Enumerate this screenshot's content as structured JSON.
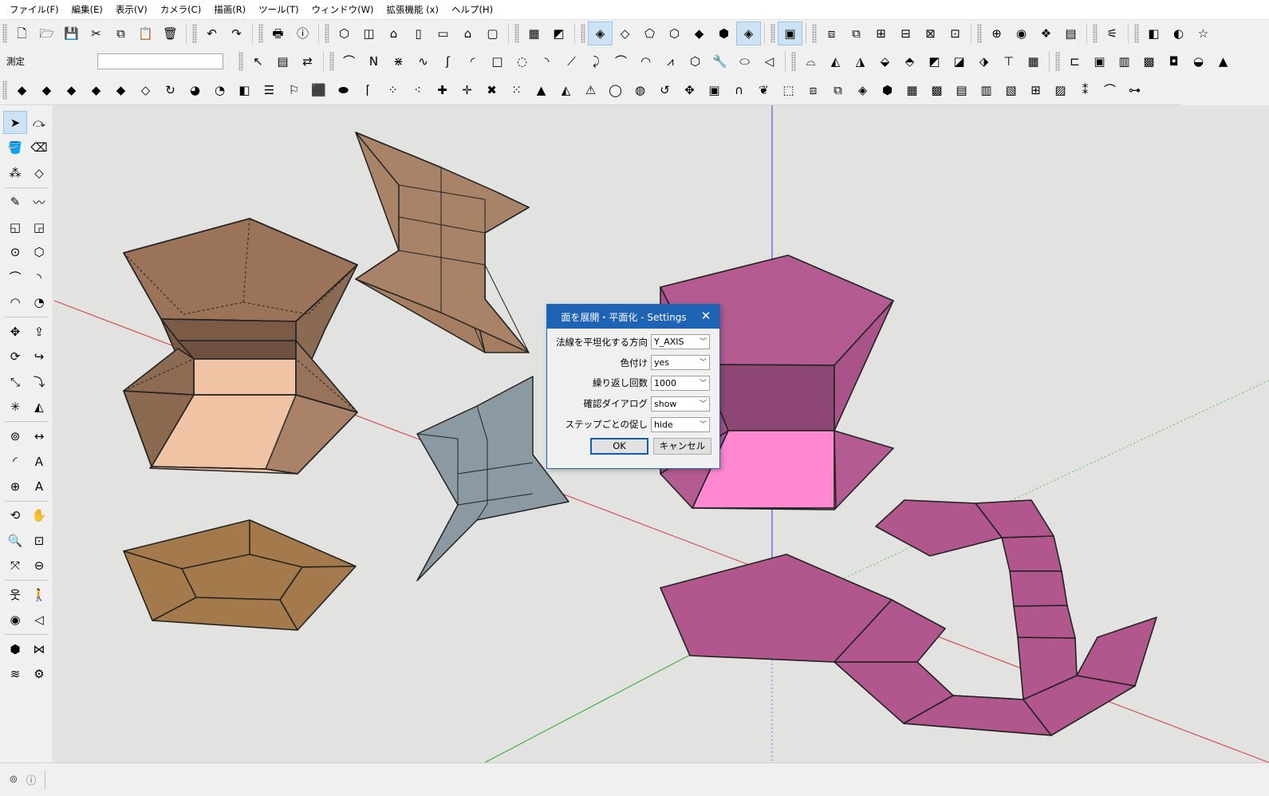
{
  "menubar": {
    "items": [
      "ファイル(F)",
      "編集(E)",
      "表示(V)",
      "カメラ(C)",
      "描画(R)",
      "ツール(T)",
      "ウィンドウ(W)",
      "拡張機能 (x)",
      "ヘルプ(H)"
    ]
  },
  "measurements": {
    "label": "測定",
    "value": ""
  },
  "toolbar_row1": [
    {
      "name": "new-file-icon",
      "glyph": "🗋"
    },
    {
      "name": "open-folder-icon",
      "glyph": "🗁"
    },
    {
      "name": "save-icon",
      "glyph": "💾"
    },
    {
      "name": "cut-icon",
      "glyph": "✂"
    },
    {
      "name": "copy-icon",
      "glyph": "⧉"
    },
    {
      "name": "paste-icon",
      "glyph": "📋"
    },
    {
      "name": "delete-icon",
      "glyph": "🗑"
    },
    {
      "name": "undo-icon",
      "glyph": "↶"
    },
    {
      "name": "redo-icon",
      "glyph": "↷"
    },
    {
      "name": "print-icon",
      "glyph": "🖶"
    },
    {
      "name": "model-info-icon",
      "glyph": "ⓘ"
    },
    {
      "name": "iso-view-icon",
      "glyph": "⬡"
    },
    {
      "name": "top-view-icon",
      "glyph": "◫"
    },
    {
      "name": "front-view-icon",
      "glyph": "⌂"
    },
    {
      "name": "right-view-icon",
      "glyph": "▯"
    },
    {
      "name": "back-view-icon",
      "glyph": "▭"
    },
    {
      "name": "left-view-icon",
      "glyph": "⌂"
    },
    {
      "name": "bottom-view-icon",
      "glyph": "▢"
    },
    {
      "name": "photo-texture-icon",
      "glyph": "▦"
    },
    {
      "name": "section-plane-icon",
      "glyph": "◩"
    },
    {
      "name": "xray-style-icon",
      "glyph": "◈"
    },
    {
      "name": "back-edges-style-icon",
      "glyph": "◇"
    },
    {
      "name": "wireframe-style-icon",
      "glyph": "⬠"
    },
    {
      "name": "hidden-line-style-icon",
      "glyph": "⬡"
    },
    {
      "name": "shaded-style-icon",
      "glyph": "◆"
    },
    {
      "name": "shaded-texture-style-icon",
      "glyph": "⬢"
    },
    {
      "name": "monochrome-style-icon",
      "glyph": "◈"
    },
    {
      "name": "component-icon",
      "glyph": "▣"
    },
    {
      "name": "solid-outer-shell-icon",
      "glyph": "⧈"
    },
    {
      "name": "solid-intersect-icon",
      "glyph": "⧉"
    },
    {
      "name": "solid-union-icon",
      "glyph": "⊞"
    },
    {
      "name": "solid-subtract-icon",
      "glyph": "⊟"
    },
    {
      "name": "solid-trim-icon",
      "glyph": "⊠"
    },
    {
      "name": "solid-split-icon",
      "glyph": "⊡"
    },
    {
      "name": "orbit-icon",
      "glyph": "⊕"
    },
    {
      "name": "warehouse-icon",
      "glyph": "◉"
    },
    {
      "name": "extension-warehouse-icon",
      "glyph": "❖"
    },
    {
      "name": "layout-icon",
      "glyph": "▤"
    },
    {
      "name": "spring-icon",
      "glyph": "⚟"
    },
    {
      "name": "cylinder-icon",
      "glyph": "◧"
    },
    {
      "name": "sphere-icon",
      "glyph": "◐"
    },
    {
      "name": "star-icon",
      "glyph": "☆"
    }
  ],
  "toolbar_row2": [
    {
      "name": "select-arrow-icon",
      "glyph": "↖"
    },
    {
      "name": "text-list-icon",
      "glyph": "▤"
    },
    {
      "name": "flip-icon",
      "glyph": "⇄"
    },
    {
      "name": "arc-curve-icon",
      "glyph": "⌒"
    },
    {
      "name": "zigzag-line-icon",
      "glyph": "Ν"
    },
    {
      "name": "fractal-line-icon",
      "glyph": "⋇"
    },
    {
      "name": "wave-line-icon",
      "glyph": "∿"
    },
    {
      "name": "spline-icon",
      "glyph": "ʃ"
    },
    {
      "name": "open-arc-icon",
      "glyph": "◜"
    },
    {
      "name": "square-outline-icon",
      "glyph": "□"
    },
    {
      "name": "spiral-icon",
      "glyph": "◌"
    },
    {
      "name": "arc-segment-icon",
      "glyph": "◝"
    },
    {
      "name": "polyline-icon",
      "glyph": "⟋"
    },
    {
      "name": "hook-curve-icon",
      "glyph": "⤸"
    },
    {
      "name": "bezier-icon",
      "glyph": "⌒"
    },
    {
      "name": "red-arc-icon",
      "glyph": "◠"
    },
    {
      "name": "vertex-line-icon",
      "glyph": "⩘"
    },
    {
      "name": "polygon-icon",
      "glyph": "⬡"
    },
    {
      "name": "wrench-icon",
      "glyph": "🔧"
    },
    {
      "name": "ellipse-icon",
      "glyph": "⬭"
    },
    {
      "name": "teardrop-icon",
      "glyph": "◁"
    },
    {
      "name": "curvilinear-loft-icon",
      "glyph": "⌓"
    },
    {
      "name": "surface-a-icon",
      "glyph": "◭"
    },
    {
      "name": "surface-b-icon",
      "glyph": "◮"
    },
    {
      "name": "surface-c-icon",
      "glyph": "⬙"
    },
    {
      "name": "surface-d-icon",
      "glyph": "⬘"
    },
    {
      "name": "surface-e-icon",
      "glyph": "◩"
    },
    {
      "name": "surface-f-icon",
      "glyph": "◪"
    },
    {
      "name": "surface-g-icon",
      "glyph": "⬗"
    },
    {
      "name": "surface-h-icon",
      "glyph": "⊤"
    },
    {
      "name": "surface-grid-icon",
      "glyph": "▦"
    },
    {
      "name": "unfold-icon",
      "glyph": "⊏"
    },
    {
      "name": "bookmark-icon",
      "glyph": "▣"
    },
    {
      "name": "chart-icon",
      "glyph": "▥"
    },
    {
      "name": "film-icon",
      "glyph": "▩"
    },
    {
      "name": "badge-icon",
      "glyph": "◘"
    },
    {
      "name": "flat-cone-icon",
      "glyph": "◒"
    },
    {
      "name": "cone-icon",
      "glyph": "▲"
    }
  ],
  "toolbar_row3": [
    {
      "name": "layer-red-icon",
      "glyph": "◆"
    },
    {
      "name": "layer-blue-icon",
      "glyph": "◆"
    },
    {
      "name": "layer-yellow-icon",
      "glyph": "◆"
    },
    {
      "name": "layer-green-icon",
      "glyph": "◆"
    },
    {
      "name": "layer-pink-icon",
      "glyph": "◆"
    },
    {
      "name": "layer-outline-icon",
      "glyph": "◇"
    },
    {
      "name": "rotate-orange-icon",
      "glyph": "↻"
    },
    {
      "name": "shape-orange-a-icon",
      "glyph": "◕"
    },
    {
      "name": "shape-orange-b-icon",
      "glyph": "◔"
    },
    {
      "name": "square-orange-icon",
      "glyph": "◧"
    },
    {
      "name": "striped-box-icon",
      "glyph": "☰"
    },
    {
      "name": "flag-icon",
      "glyph": "⚐"
    },
    {
      "name": "box-3d-icon",
      "glyph": "⬛"
    },
    {
      "name": "pipe-icon",
      "glyph": "⬬"
    },
    {
      "name": "corner-icon",
      "glyph": "⌈"
    },
    {
      "name": "dot-line-a-icon",
      "glyph": "⁘"
    },
    {
      "name": "dot-line-b-icon",
      "glyph": "⁖"
    },
    {
      "name": "cross-red-icon",
      "glyph": "✚"
    },
    {
      "name": "cross-green-icon",
      "glyph": "✛"
    },
    {
      "name": "x-cross-icon",
      "glyph": "✖"
    },
    {
      "name": "dot-grid-icon",
      "glyph": "⁙"
    },
    {
      "name": "water-drop-icon",
      "glyph": "▲"
    },
    {
      "name": "fill-triangle-icon",
      "glyph": "◭"
    },
    {
      "name": "warning-triangle-icon",
      "glyph": "⚠"
    },
    {
      "name": "ring-yellow-icon",
      "glyph": "◯"
    },
    {
      "name": "ring-split-icon",
      "glyph": "◍"
    },
    {
      "name": "ring-refresh-icon",
      "glyph": "↺"
    },
    {
      "name": "move-arrows-icon",
      "glyph": "✥"
    },
    {
      "name": "push-box-icon",
      "glyph": "▣"
    },
    {
      "name": "magnet-icon",
      "glyph": "∩"
    },
    {
      "name": "leaf-cube-icon",
      "glyph": "❦"
    },
    {
      "name": "cube-a-icon",
      "glyph": "⬚"
    },
    {
      "name": "cube-b-icon",
      "glyph": "⧈"
    },
    {
      "name": "cube-c-icon",
      "glyph": "⧉"
    },
    {
      "name": "cube-d-icon",
      "glyph": "◈"
    },
    {
      "name": "cube-e-icon",
      "glyph": "⬢"
    },
    {
      "name": "grid-box-a-icon",
      "glyph": "▦"
    },
    {
      "name": "grid-box-b-icon",
      "glyph": "▩"
    },
    {
      "name": "grid-box-c-icon",
      "glyph": "▤"
    },
    {
      "name": "grid-box-d-icon",
      "glyph": "▥"
    },
    {
      "name": "orange-grid-a-icon",
      "glyph": "▧"
    },
    {
      "name": "orange-grid-b-icon",
      "glyph": "⊞"
    },
    {
      "name": "orange-grid-c-icon",
      "glyph": "▨"
    },
    {
      "name": "scatter-x-icon",
      "glyph": "⁑"
    },
    {
      "name": "arc-dots-icon",
      "glyph": "⌒"
    },
    {
      "name": "network-icon",
      "glyph": "⊶"
    }
  ],
  "left_tools": [
    [
      {
        "name": "select-tool-icon",
        "glyph": "➤",
        "sel": true
      },
      {
        "name": "lasso-select-icon",
        "glyph": "⤼"
      }
    ],
    [
      {
        "name": "paint-bucket-icon",
        "glyph": "🪣"
      },
      {
        "name": "eraser-icon",
        "glyph": "⌫"
      }
    ],
    [
      {
        "name": "component-tool-icon",
        "glyph": "⁂"
      },
      {
        "name": "tag-eraser-icon",
        "glyph": "◇"
      }
    ],
    [
      "sep"
    ],
    [
      {
        "name": "pencil-line-icon",
        "glyph": "✎"
      },
      {
        "name": "freehand-icon",
        "glyph": "〰"
      }
    ],
    [
      {
        "name": "rectangle-tool-icon",
        "glyph": "◱"
      },
      {
        "name": "rotated-rectangle-icon",
        "glyph": "◲"
      }
    ],
    [
      {
        "name": "circle-tool-icon",
        "glyph": "⊙"
      },
      {
        "name": "polygon-tool-icon",
        "glyph": "⬡"
      }
    ],
    [
      {
        "name": "arc-tool-icon",
        "glyph": "⌒"
      },
      {
        "name": "arc-2pt-icon",
        "glyph": "◝"
      }
    ],
    [
      {
        "name": "arc-3pt-icon",
        "glyph": "◠"
      },
      {
        "name": "pie-tool-icon",
        "glyph": "◔"
      }
    ],
    [
      "sep"
    ],
    [
      {
        "name": "move-tool-icon",
        "glyph": "✥"
      },
      {
        "name": "push-pull-icon",
        "glyph": "⇪"
      }
    ],
    [
      {
        "name": "rotate-tool-icon",
        "glyph": "⟳"
      },
      {
        "name": "follow-me-icon",
        "glyph": "↪"
      }
    ],
    [
      {
        "name": "scale-tool-icon",
        "glyph": "⤡"
      },
      {
        "name": "offset-tool-icon",
        "glyph": "⤵"
      }
    ],
    [
      {
        "name": "explode-icon",
        "glyph": "✳"
      },
      {
        "name": "mirror-icon",
        "glyph": "◭"
      }
    ],
    [
      "sep"
    ],
    [
      {
        "name": "tape-measure-icon",
        "glyph": "⊚"
      },
      {
        "name": "dimension-icon",
        "glyph": "↔"
      }
    ],
    [
      {
        "name": "protractor-icon",
        "glyph": "◜"
      },
      {
        "name": "text-label-icon",
        "glyph": "Ａ"
      }
    ],
    [
      {
        "name": "axes-tool-icon",
        "glyph": "⊕"
      },
      {
        "name": "3d-text-icon",
        "glyph": "A"
      }
    ],
    [
      "sep"
    ],
    [
      {
        "name": "orbit-tool-icon",
        "glyph": "⟲"
      },
      {
        "name": "pan-hand-icon",
        "glyph": "✋"
      }
    ],
    [
      {
        "name": "zoom-icon",
        "glyph": "🔍"
      },
      {
        "name": "zoom-window-icon",
        "glyph": "⊡"
      }
    ],
    [
      {
        "name": "zoom-extents-icon",
        "glyph": "⤧"
      },
      {
        "name": "zoom-previous-icon",
        "glyph": "⊖"
      }
    ],
    [
      "sep"
    ],
    [
      {
        "name": "position-camera-icon",
        "glyph": "웃"
      },
      {
        "name": "walk-icon",
        "glyph": "🚶"
      }
    ],
    [
      {
        "name": "look-around-icon",
        "glyph": "◉"
      },
      {
        "name": "section-view-icon",
        "glyph": "◁"
      }
    ],
    [
      "sep"
    ],
    [
      {
        "name": "sandbox-from-contours-icon",
        "glyph": "⬢"
      },
      {
        "name": "sandbox-scratch-icon",
        "glyph": "⋈"
      }
    ],
    [
      {
        "name": "sandbox-smoove-icon",
        "glyph": "≋"
      },
      {
        "name": "sandbox-stamp-icon",
        "glyph": "⚙"
      }
    ]
  ],
  "dialog": {
    "title": "面を展開・平面化 - Settings",
    "rows": [
      {
        "label": "法線を平坦化する方向",
        "value": "Y_AXIS"
      },
      {
        "label": "色付け",
        "value": "yes"
      },
      {
        "label": "繰り返し回数",
        "value": "1000"
      },
      {
        "label": "確認ダイアログ",
        "value": "show"
      },
      {
        "label": "ステップごとの促し",
        "value": "hide"
      }
    ],
    "ok_label": "OK",
    "cancel_label": "キャンセル"
  },
  "statusbar": {
    "icons": [
      "geo-location-icon",
      "info-icon"
    ]
  },
  "colors": {
    "accent": "#1e63b4",
    "viewport_bg": "#e2e2e1",
    "brown_face": "#a57a5c",
    "brown_light": "#f0c3a5",
    "tan_flat": "#a47a4c",
    "grey_face": "#8b9aa2",
    "magenta_face": "#b2578e",
    "pink_face": "#ff88d0"
  }
}
